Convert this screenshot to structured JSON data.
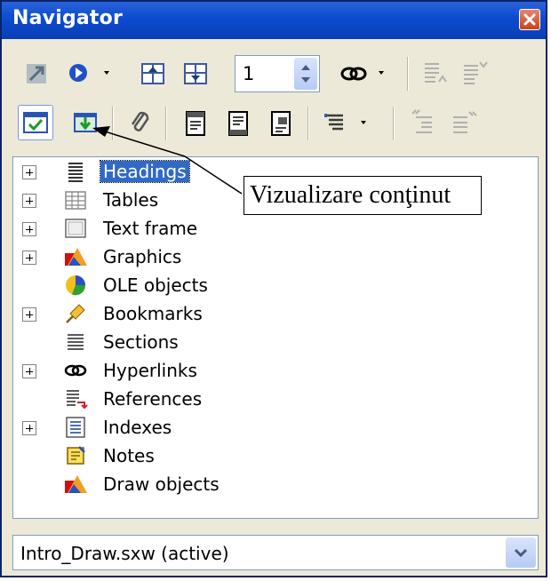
{
  "window": {
    "title": "Navigator"
  },
  "toolbar": {
    "page_number_value": "1",
    "buttons": [
      "toggle-icon",
      "navigation-icon",
      "previous-icon",
      "next-icon",
      "hyperlink-mode-icon",
      "promote-level-icon",
      "demote-level-icon",
      "list-box-icon",
      "content-view-icon",
      "set-reminder-icon",
      "header-icon",
      "footer-icon",
      "anchor-icon",
      "heading-levels-icon",
      "promote-chapter-icon",
      "demote-chapter-icon"
    ]
  },
  "tree": {
    "items": [
      {
        "label": "Headings",
        "icon": "headings-icon",
        "expandable": true,
        "selected": true
      },
      {
        "label": "Tables",
        "icon": "tables-icon",
        "expandable": true
      },
      {
        "label": "Text frame",
        "icon": "text-frame-icon",
        "expandable": true
      },
      {
        "label": "Graphics",
        "icon": "graphics-icon",
        "expandable": true
      },
      {
        "label": "OLE objects",
        "icon": "ole-objects-icon",
        "expandable": false
      },
      {
        "label": "Bookmarks",
        "icon": "bookmarks-icon",
        "expandable": true
      },
      {
        "label": "Sections",
        "icon": "sections-icon",
        "expandable": false
      },
      {
        "label": "Hyperlinks",
        "icon": "hyperlinks-icon",
        "expandable": true
      },
      {
        "label": "References",
        "icon": "references-icon",
        "expandable": false
      },
      {
        "label": "Indexes",
        "icon": "indexes-icon",
        "expandable": true
      },
      {
        "label": "Notes",
        "icon": "notes-icon",
        "expandable": false
      },
      {
        "label": "Draw objects",
        "icon": "draw-objects-icon",
        "expandable": false
      }
    ]
  },
  "callout": {
    "text": "Vizualizare conţinut"
  },
  "document_select": {
    "value": "Intro_Draw.sxw (active)"
  },
  "colors": {
    "titlebar": "#0b4bd0",
    "selection": "#316ac5",
    "chrome": "#ece9d8"
  }
}
